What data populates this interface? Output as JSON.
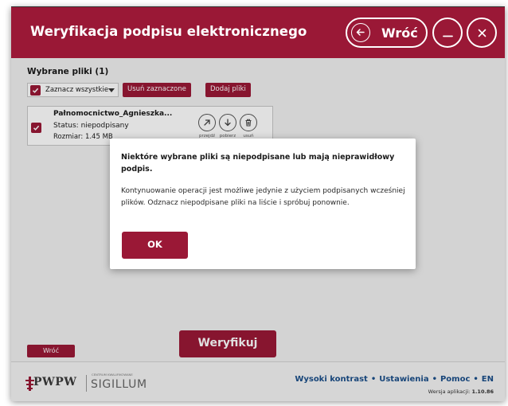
{
  "window": {
    "title": "Weryfikacja podpisu elektronicznego",
    "back_label": "Wróć"
  },
  "files": {
    "heading": "Wybrane pliki",
    "count": "(1)",
    "select_all_label": "Zaznacz wszystkie",
    "remove_selected_label": "Usuń zaznaczone",
    "add_files_label": "Dodaj pliki",
    "items": [
      {
        "name": "Pałnomocnictwo_Agnieszka...",
        "status": "Status: niepodpisany",
        "size": "Rozmiar: 1.45 MB",
        "actions": {
          "open": "przejdź",
          "download": "pobierz",
          "remove": "usuń"
        }
      }
    ]
  },
  "modal": {
    "title": "Niektóre wybrane pliki są niepodpisane lub mają nieprawidłowy podpis.",
    "body": "Kontynuowanie operacji jest możliwe jedynie z użyciem podpisanych wcześniej plików. Odznacz niepodpisane pliki na liście i spróbuj ponownie.",
    "ok_label": "OK"
  },
  "bottom": {
    "back_label": "Wróć",
    "verify_label": "Weryfikuj"
  },
  "footer": {
    "logo_text": "PWPW",
    "logo_small": "CENTRUM KWALIFIKOWANE",
    "logo_brand": "SIGILLUM",
    "links": [
      "Wysoki kontrast",
      "Ustawienia",
      "Pomoc",
      "EN"
    ],
    "version_label": "Wersja aplikacji:",
    "version_value": "1.10.86"
  },
  "colors": {
    "brand": "#9a1836",
    "link": "#1b4f8a"
  }
}
